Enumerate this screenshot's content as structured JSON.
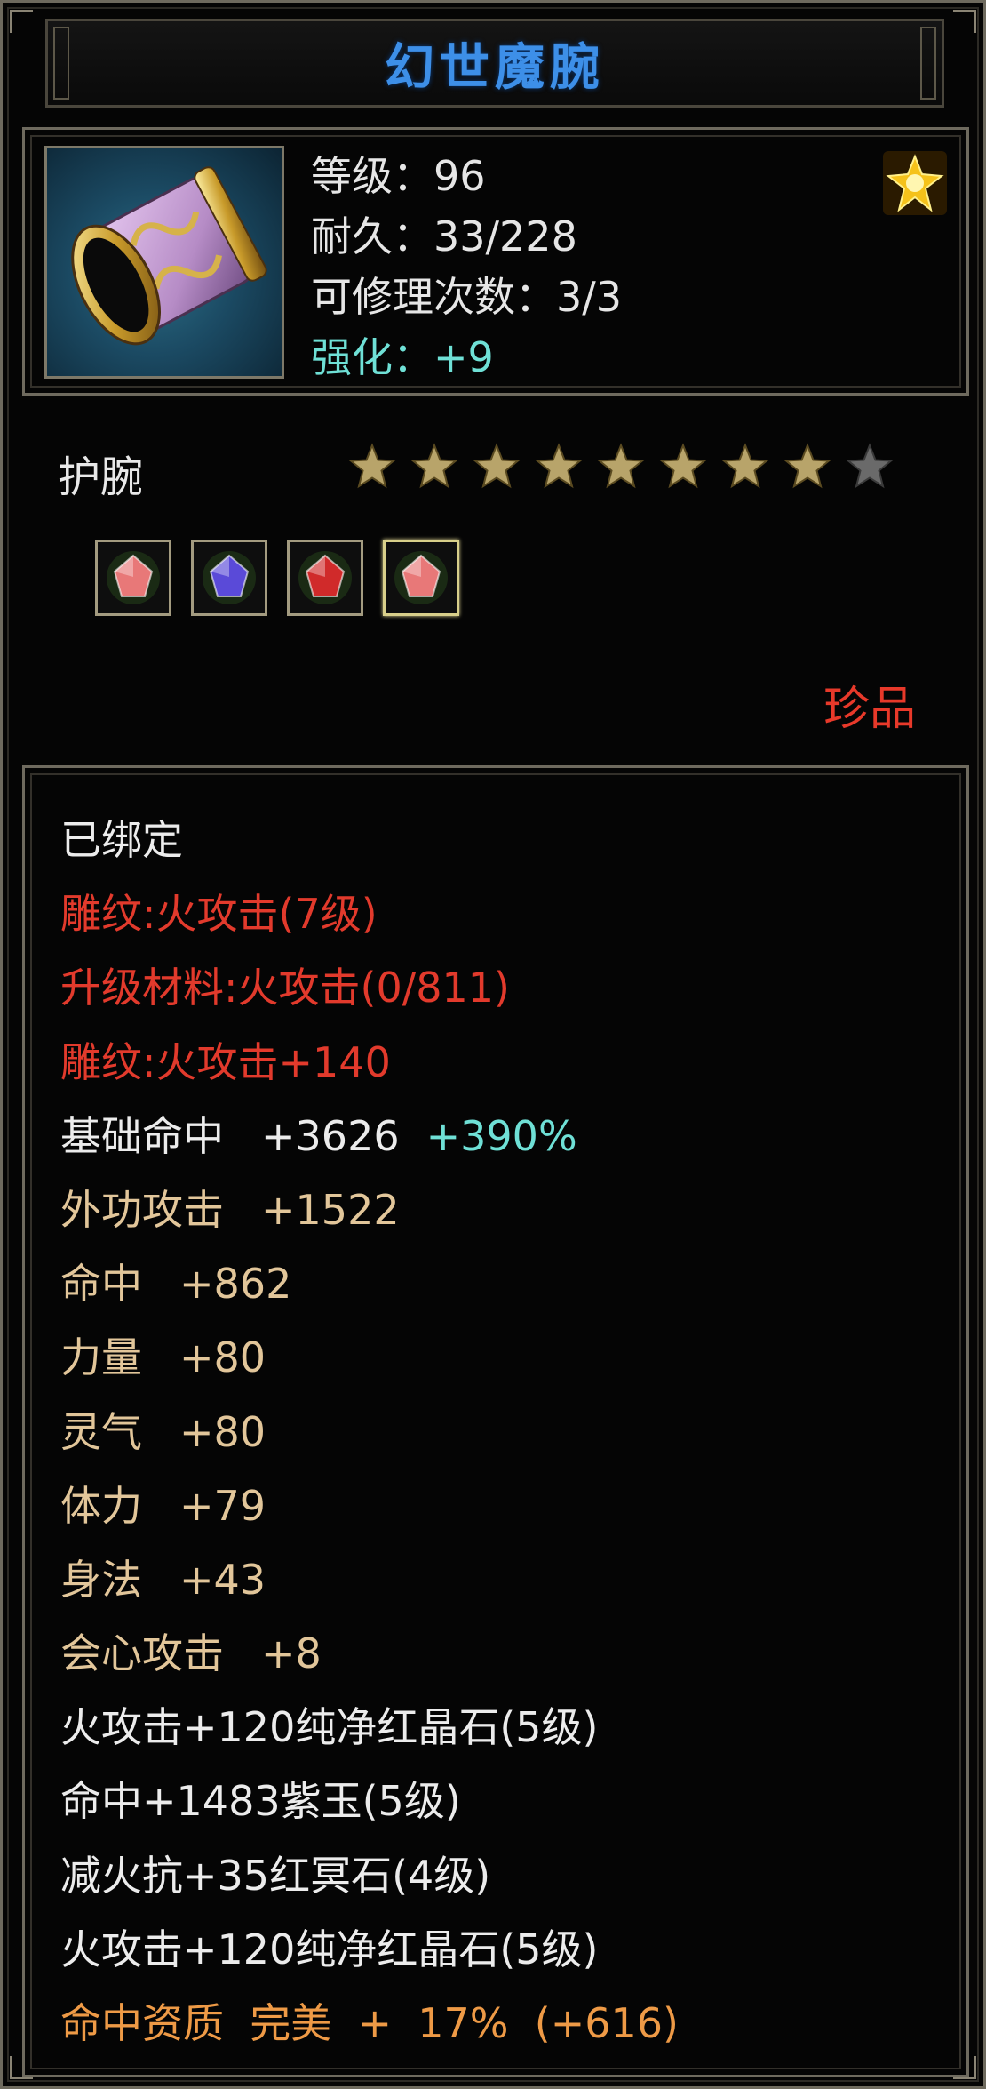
{
  "item": {
    "name": "幻世魔腕",
    "level_line": "等级：96",
    "durability_line": "耐久：33/228",
    "repair_line": "可修理次数：3/3",
    "enhance_line": "强化：+9"
  },
  "type_label": "护腕",
  "stars": {
    "total": 9,
    "filled": 8
  },
  "gems": [
    {
      "name": "pink-gem-icon",
      "color": "#e87878",
      "active": false
    },
    {
      "name": "purple-gem-icon",
      "color": "#5a4ad8",
      "active": false
    },
    {
      "name": "red-gem-icon",
      "color": "#d02a2a",
      "active": false
    },
    {
      "name": "pink-gem-icon",
      "color": "#e87878",
      "active": true
    }
  ],
  "rarity": "珍品",
  "attributes": {
    "bound": "已绑定",
    "engrave_1": "雕纹:火攻击(7级)",
    "upgrade_material": "升级材料:火攻击(0/811)",
    "engrave_2": "雕纹:火攻击+140",
    "base_hit": {
      "label": "基础命中",
      "value": "+3626",
      "bonus": "+390%"
    },
    "ext_attack": {
      "label": "外功攻击",
      "value": "+1522"
    },
    "hit": {
      "label": "命中",
      "value": "+862"
    },
    "strength": {
      "label": "力量",
      "value": "+80"
    },
    "spirit": {
      "label": "灵气",
      "value": "+80"
    },
    "stamina": {
      "label": "体力",
      "value": "+79"
    },
    "agility": {
      "label": "身法",
      "value": "+43"
    },
    "crit_attack": {
      "label": "会心攻击",
      "value": "+8"
    },
    "gem_1": "火攻击+120纯净红晶石(5级)",
    "gem_2": "命中+1483紫玉(5级)",
    "gem_3": "减火抗+35红冥石(4级)",
    "gem_4": "火攻击+120纯净红晶石(5级)",
    "aptitude": "命中资质  完美  +  17%  (+616)"
  },
  "colors": {
    "title": "#3d8fe8",
    "enhance": "#6fe0d6",
    "red_text": "#e23a2c",
    "tan_text": "#e2c69a",
    "orange_text": "#ee9a46",
    "star_filled": "#b8a46a",
    "star_empty": "#6a6a6a"
  }
}
